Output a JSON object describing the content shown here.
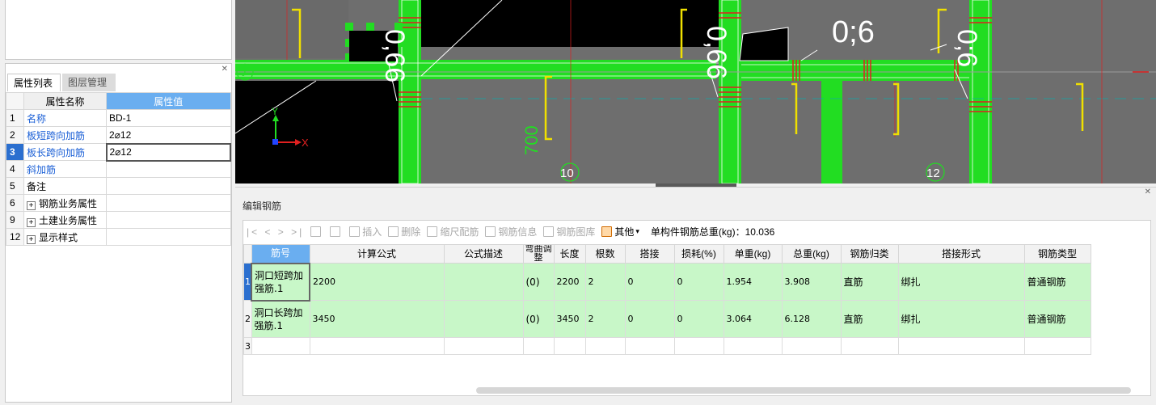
{
  "properties_panel": {
    "tabs": [
      {
        "label": "属性列表",
        "active": true
      },
      {
        "label": "图层管理",
        "active": false
      }
    ],
    "columns": {
      "name": "属性名称",
      "value": "属性值"
    },
    "rows": [
      {
        "num": "1",
        "name": "名称",
        "value": "BD-1",
        "link": true
      },
      {
        "num": "2",
        "name": "板短跨向加筋",
        "value": "2⌀12",
        "link": true
      },
      {
        "num": "3",
        "name": "板长跨向加筋",
        "value": "2⌀12",
        "link": true,
        "selected": true
      },
      {
        "num": "4",
        "name": "斜加筋",
        "value": "",
        "link": true
      },
      {
        "num": "5",
        "name": "备注",
        "value": "",
        "link": false
      },
      {
        "num": "6",
        "name": "钢筋业务属性",
        "value": "",
        "group": true
      },
      {
        "num": "9",
        "name": "土建业务属性",
        "value": "",
        "group": true
      },
      {
        "num": "12",
        "name": "显示样式",
        "value": "",
        "group": true
      }
    ]
  },
  "cad_view": {
    "axis_label": "J",
    "grid_labels": [
      "10",
      "12"
    ],
    "dimension_texts": [
      "0,66",
      "0,66",
      "0;6",
      "0;6"
    ],
    "vertical_text": "700",
    "axis_y": "Y",
    "axis_x": "X"
  },
  "edit_panel": {
    "title": "编辑钢筋",
    "toolbar": {
      "nav": "|< < > >|",
      "insert": "插入",
      "delete": "删除",
      "scale_rebar": "缩尺配筋",
      "rebar_info": "钢筋信息",
      "rebar_library": "钢筋图库",
      "other": "其他",
      "total_weight_label": "单构件钢筋总重(kg)：",
      "total_weight_value": "10.036"
    },
    "columns": [
      "筋号",
      "计算公式",
      "公式描述",
      "弯曲调整",
      "长度",
      "根数",
      "搭接",
      "损耗(%)",
      "单重(kg)",
      "总重(kg)",
      "钢筋归类",
      "搭接形式",
      "钢筋类型"
    ],
    "rows": [
      {
        "num": "1",
        "bar_no": "洞口短跨加强筋.1",
        "formula": "2200",
        "formula_desc": "",
        "bend_adjust": "(0)",
        "length": "2200",
        "count": "2",
        "lap": "0",
        "loss": "0",
        "unit_weight": "1.954",
        "total_weight": "3.908",
        "category": "直筋",
        "lap_type": "绑扎",
        "rebar_type": "普通钢筋"
      },
      {
        "num": "2",
        "bar_no": "洞口长跨加强筋.1",
        "formula": "3450",
        "formula_desc": "",
        "bend_adjust": "(0)",
        "length": "3450",
        "count": "2",
        "lap": "0",
        "loss": "0",
        "unit_weight": "3.064",
        "total_weight": "6.128",
        "category": "直筋",
        "lap_type": "绑扎",
        "rebar_type": "普通钢筋"
      },
      {
        "num": "3",
        "bar_no": "",
        "formula": "",
        "formula_desc": "",
        "bend_adjust": "",
        "length": "",
        "count": "",
        "lap": "",
        "loss": "",
        "unit_weight": "",
        "total_weight": "",
        "category": "",
        "lap_type": "",
        "rebar_type": ""
      }
    ]
  },
  "colors": {
    "accent_blue": "#6aaef0",
    "row_green": "#c8f7c8",
    "cad_green": "#22dd22",
    "cad_bg": "#6e6e6e"
  }
}
